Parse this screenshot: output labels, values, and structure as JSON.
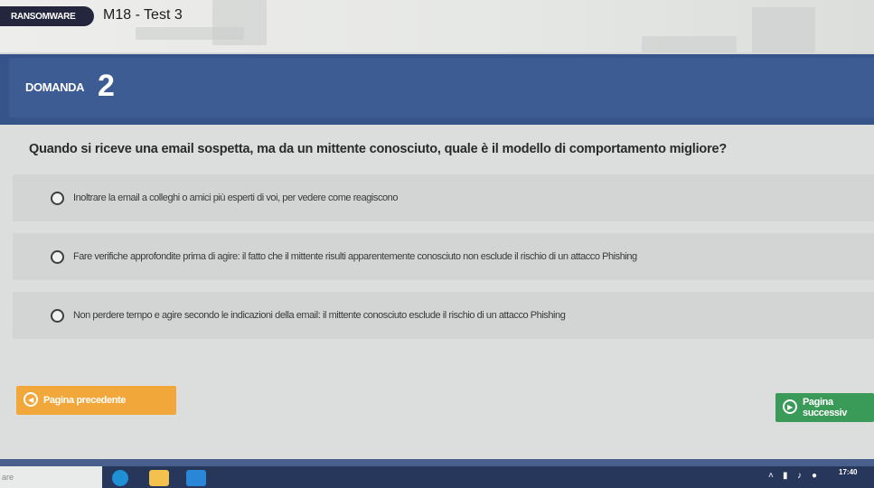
{
  "header": {
    "badge": "RANSOMWARE",
    "title": "M18 - Test 3"
  },
  "question_block": {
    "label": "DOMANDA",
    "number": "2",
    "text": "Quando si riceve una email sospetta, ma da un mittente conosciuto, quale è il modello di comportamento migliore?",
    "options": [
      {
        "text": "Inoltrare la email a colleghi o amici più esperti di voi, per vedere come reagiscono"
      },
      {
        "text": "Fare verifiche approfondite prima di agire: il fatto che il mittente risulti apparentemente conosciuto non esclude il rischio di un attacco Phishing"
      },
      {
        "text": "Non perdere tempo e agire secondo le indicazioni della email: il mittente conosciuto esclude il rischio di un attacco Phishing"
      }
    ]
  },
  "navigation": {
    "prev_label": "Pagina precedente",
    "next_label": "Pagina successiv"
  },
  "taskbar": {
    "search_placeholder": "are",
    "clock": "17:40"
  },
  "colors": {
    "banner": "#3d5c94",
    "badge": "#23263c",
    "prev_button": "#f2a73b",
    "next_button": "#3a9a58",
    "taskbar": "#27365b"
  },
  "icons": [
    "chevron-left-icon",
    "play-icon",
    "edge-icon",
    "folder-icon",
    "store-icon",
    "wifi-icon",
    "volume-icon"
  ]
}
